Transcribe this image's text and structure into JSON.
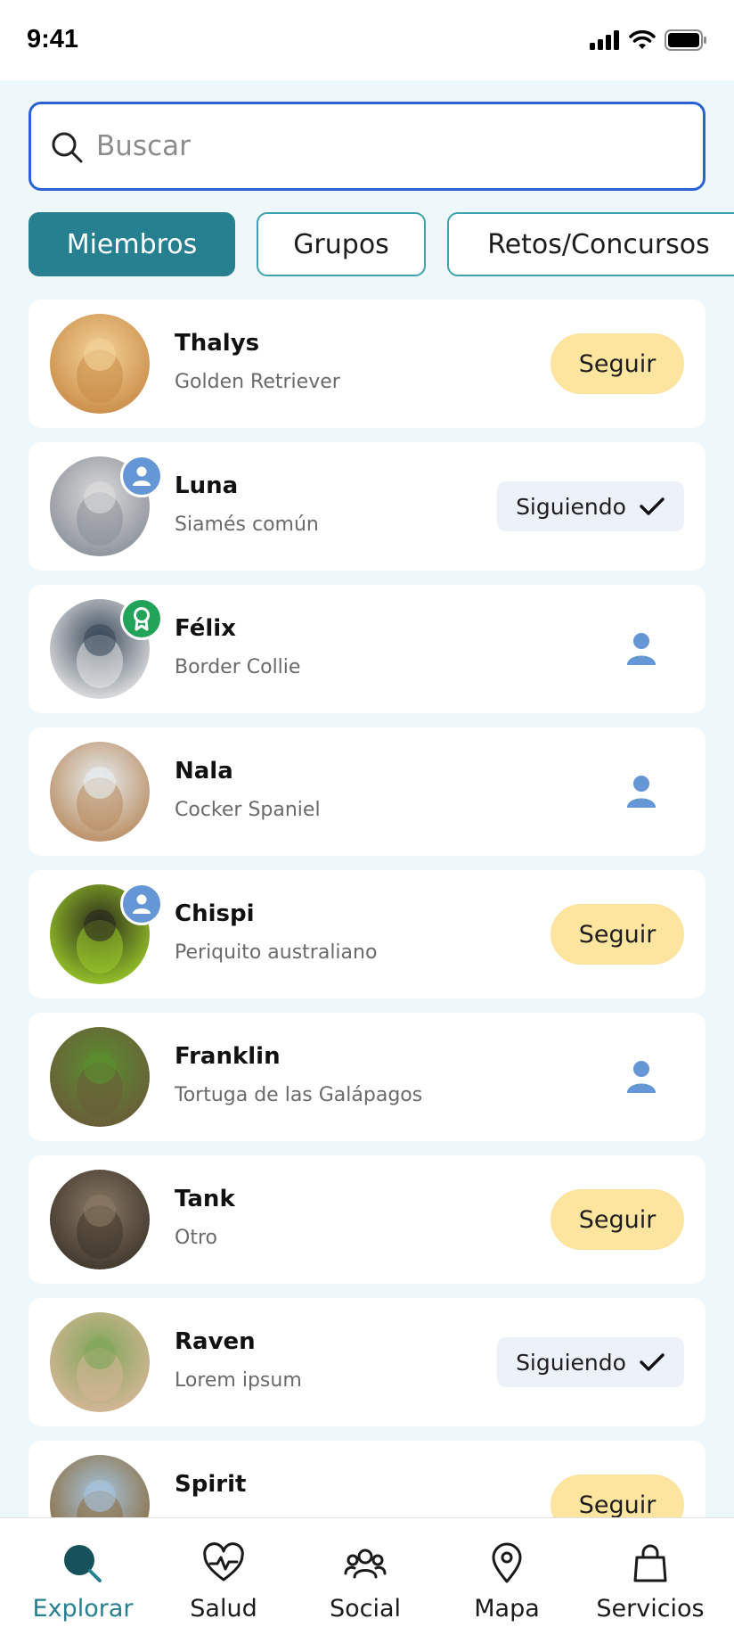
{
  "status_bar": {
    "time": "9:41"
  },
  "search": {
    "placeholder": "Buscar",
    "value": ""
  },
  "tabs": [
    {
      "label": "Miembros",
      "active": true
    },
    {
      "label": "Grupos",
      "active": false
    },
    {
      "label": "Retos/Concursos",
      "active": false
    }
  ],
  "members": [
    {
      "name": "Thalys",
      "breed": "Golden Retriever",
      "action": "Seguir",
      "badge": "none",
      "avatar_colors": [
        "#f3d49a",
        "#c98a45"
      ]
    },
    {
      "name": "Luna",
      "breed": "Siamés común",
      "action": "Siguiendo",
      "badge": "user",
      "avatar_colors": [
        "#dcdcdc",
        "#8a8f98"
      ]
    },
    {
      "name": "Félix",
      "breed": "Border Collie",
      "action": "friend",
      "badge": "award",
      "avatar_colors": [
        "#3a4a5a",
        "#e8e8e8"
      ]
    },
    {
      "name": "Nala",
      "breed": "Cocker Spaniel",
      "action": "friend",
      "badge": "none",
      "avatar_colors": [
        "#e7eef2",
        "#b88a5d"
      ]
    },
    {
      "name": "Chispi",
      "breed": "Periquito australiano",
      "action": "Seguir",
      "badge": "user",
      "avatar_colors": [
        "#2a2a1c",
        "#9ccc2a"
      ]
    },
    {
      "name": "Franklin",
      "breed": "Tortuga de las Galápagos",
      "action": "friend",
      "badge": "none",
      "avatar_colors": [
        "#5a8f2e",
        "#6b5a3a"
      ]
    },
    {
      "name": "Tank",
      "breed": "Otro",
      "action": "Seguir",
      "badge": "none",
      "avatar_colors": [
        "#8a7a66",
        "#3e342a"
      ]
    },
    {
      "name": "Raven",
      "breed": "Lorem ipsum",
      "action": "Siguiendo",
      "badge": "none",
      "avatar_colors": [
        "#7fa658",
        "#d9b79a"
      ]
    },
    {
      "name": "Spirit",
      "breed": "",
      "action": "Seguir",
      "badge": "none",
      "avatar_colors": [
        "#a7c5e0",
        "#8a6a3a"
      ]
    }
  ],
  "bottom_nav": [
    {
      "label": "Explorar",
      "icon": "search-icon",
      "active": true
    },
    {
      "label": "Salud",
      "icon": "heart-pulse-icon",
      "active": false
    },
    {
      "label": "Social",
      "icon": "group-icon",
      "active": false
    },
    {
      "label": "Mapa",
      "icon": "map-pin-icon",
      "active": false
    },
    {
      "label": "Servicios",
      "icon": "shopping-bag-icon",
      "active": false
    }
  ],
  "colors": {
    "accent": "#27808f",
    "follow_button": "#fde49f",
    "following_button": "#edf1f9",
    "badge_user": "#6596d6",
    "badge_award": "#22a35a",
    "search_border": "#2a62d6"
  }
}
